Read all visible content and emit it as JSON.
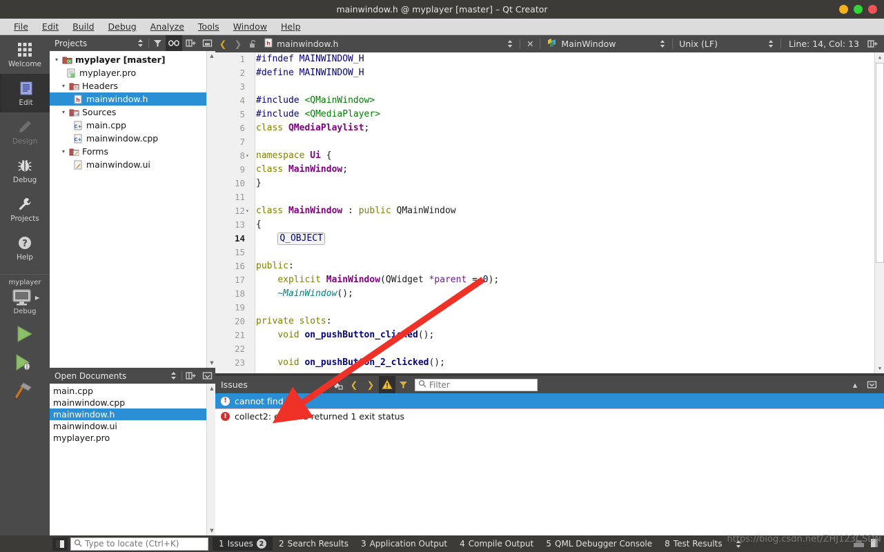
{
  "window": {
    "title": "mainwindow.h @ myplayer [master] – Qt Creator",
    "controls": {
      "minimize": "minimize",
      "maximize": "maximize",
      "close": "close"
    }
  },
  "menubar": [
    {
      "label": "File"
    },
    {
      "label": "Edit"
    },
    {
      "label": "Build"
    },
    {
      "label": "Debug"
    },
    {
      "label": "Analyze"
    },
    {
      "label": "Tools"
    },
    {
      "label": "Window"
    },
    {
      "label": "Help"
    }
  ],
  "modebar": {
    "items": [
      {
        "label": "Welcome",
        "icon": "grid-icon",
        "state": "normal"
      },
      {
        "label": "Edit",
        "icon": "document-icon",
        "state": "active"
      },
      {
        "label": "Design",
        "icon": "pencil-icon",
        "state": "disabled"
      },
      {
        "label": "Debug",
        "icon": "bug-icon",
        "state": "normal"
      },
      {
        "label": "Projects",
        "icon": "wrench-icon",
        "state": "normal"
      },
      {
        "label": "Help",
        "icon": "question-icon",
        "state": "normal"
      }
    ],
    "kit": {
      "project": "myplayer",
      "config": "Debug"
    },
    "actions": [
      {
        "name": "run",
        "icon": "play-icon"
      },
      {
        "name": "debug",
        "icon": "play-bug-icon"
      },
      {
        "name": "build",
        "icon": "hammer-icon"
      }
    ]
  },
  "projects_panel": {
    "title": "Projects",
    "toolbar": [
      {
        "name": "sort-button",
        "icon": "updown-icon"
      },
      {
        "name": "filter-button",
        "icon": "funnel-icon"
      },
      {
        "name": "synchronize-button",
        "icon": "link-icon",
        "active": true
      },
      {
        "name": "split-button",
        "icon": "split-icon"
      },
      {
        "name": "close-button",
        "icon": "close-panel-icon"
      }
    ],
    "tree": [
      {
        "label": "myplayer [master]",
        "depth": 0,
        "icon": "qt-project-icon",
        "twist": "open",
        "bold": true
      },
      {
        "label": "myplayer.pro",
        "depth": 1,
        "icon": "pro-file-icon",
        "twist": "none"
      },
      {
        "label": "Headers",
        "depth": 1,
        "icon": "headers-folder-icon",
        "twist": "open"
      },
      {
        "label": "mainwindow.h",
        "depth": 2,
        "icon": "header-file-icon",
        "twist": "none",
        "selected": true
      },
      {
        "label": "Sources",
        "depth": 1,
        "icon": "sources-folder-icon",
        "twist": "open"
      },
      {
        "label": "main.cpp",
        "depth": 2,
        "icon": "cpp-file-icon",
        "twist": "none"
      },
      {
        "label": "mainwindow.cpp",
        "depth": 2,
        "icon": "cpp-file-icon",
        "twist": "none"
      },
      {
        "label": "Forms",
        "depth": 1,
        "icon": "forms-folder-icon",
        "twist": "open"
      },
      {
        "label": "mainwindow.ui",
        "depth": 2,
        "icon": "ui-file-icon",
        "twist": "none"
      }
    ]
  },
  "open_documents": {
    "title": "Open Documents",
    "toolbar": [
      {
        "name": "sort-button",
        "icon": "updown-icon"
      },
      {
        "name": "split-button",
        "icon": "split-icon"
      },
      {
        "name": "close-button",
        "icon": "close-panel-icon"
      }
    ],
    "items": [
      {
        "label": "main.cpp"
      },
      {
        "label": "mainwindow.cpp"
      },
      {
        "label": "mainwindow.h",
        "selected": true
      },
      {
        "label": "mainwindow.ui"
      },
      {
        "label": "myplayer.pro"
      }
    ]
  },
  "editor": {
    "toolbar": {
      "back": "back-icon",
      "forward": "forward-icon",
      "lock": "unlocked-icon",
      "file_icon": "header-file-icon",
      "file_name": "mainwindow.h",
      "close": "close-icon",
      "symbol_icon": "class-icon",
      "symbol_name": "MainWindow",
      "line_ending": "Unix (LF)",
      "cursor_position": "Line: 14, Col: 13",
      "split_icon": "split-icon"
    },
    "lines": [
      {
        "n": 1,
        "fold": "",
        "tokens": [
          {
            "t": "#ifndef MAINWINDOW_H",
            "c": "c-pre"
          }
        ]
      },
      {
        "n": 2,
        "fold": "",
        "tokens": [
          {
            "t": "#define MAINWINDOW_H",
            "c": "c-pre"
          }
        ]
      },
      {
        "n": 3,
        "fold": "",
        "tokens": []
      },
      {
        "n": 4,
        "fold": "",
        "tokens": [
          {
            "t": "#include ",
            "c": "c-pre"
          },
          {
            "t": "<QMainWindow>",
            "c": "c-inc"
          }
        ]
      },
      {
        "n": 5,
        "fold": "",
        "tokens": [
          {
            "t": "#include ",
            "c": "c-pre"
          },
          {
            "t": "<QMediaPlayer>",
            "c": "c-inc"
          }
        ]
      },
      {
        "n": 6,
        "fold": "",
        "tokens": [
          {
            "t": "class ",
            "c": "c-kw"
          },
          {
            "t": "QMediaPlaylist",
            "c": "c-type"
          },
          {
            "t": ";",
            "c": "c-pln"
          }
        ]
      },
      {
        "n": 7,
        "fold": "",
        "tokens": []
      },
      {
        "n": 8,
        "fold": "open",
        "tokens": [
          {
            "t": "namespace ",
            "c": "c-kw"
          },
          {
            "t": "Ui",
            "c": "c-type"
          },
          {
            "t": " {",
            "c": "c-pln"
          }
        ]
      },
      {
        "n": 9,
        "fold": "",
        "tokens": [
          {
            "t": "class ",
            "c": "c-kw"
          },
          {
            "t": "MainWindow",
            "c": "c-type"
          },
          {
            "t": ";",
            "c": "c-pln"
          }
        ]
      },
      {
        "n": 10,
        "fold": "",
        "tokens": [
          {
            "t": "}",
            "c": "c-pln"
          }
        ]
      },
      {
        "n": 11,
        "fold": "",
        "tokens": []
      },
      {
        "n": 12,
        "fold": "open",
        "tokens": [
          {
            "t": "class ",
            "c": "c-kw"
          },
          {
            "t": "MainWindow",
            "c": "c-type"
          },
          {
            "t": " : ",
            "c": "c-pln"
          },
          {
            "t": "public ",
            "c": "c-kw"
          },
          {
            "t": "QMainWindow",
            "c": "c-pln"
          }
        ]
      },
      {
        "n": 13,
        "fold": "",
        "tokens": [
          {
            "t": "{",
            "c": "c-pln"
          }
        ]
      },
      {
        "n": 14,
        "fold": "",
        "current": true,
        "tokens": [
          {
            "t": "    ",
            "c": "c-pln"
          },
          {
            "t": "Q_OBJECT",
            "c": "c-pre",
            "box": true
          }
        ]
      },
      {
        "n": 15,
        "fold": "",
        "tokens": []
      },
      {
        "n": 16,
        "fold": "",
        "tokens": [
          {
            "t": "public",
            "c": "c-kw"
          },
          {
            "t": ":",
            "c": "c-pln"
          }
        ]
      },
      {
        "n": 17,
        "fold": "",
        "tokens": [
          {
            "t": "    ",
            "c": "c-pln"
          },
          {
            "t": "explicit ",
            "c": "c-kw"
          },
          {
            "t": "MainWindow",
            "c": "c-type"
          },
          {
            "t": "(",
            "c": "c-pln"
          },
          {
            "t": "QWidget ",
            "c": "c-pln"
          },
          {
            "t": "*parent",
            "c": "c-var"
          },
          {
            "t": " = ",
            "c": "c-pln"
          },
          {
            "t": "0",
            "c": "c-num"
          },
          {
            "t": ");",
            "c": "c-pln"
          }
        ]
      },
      {
        "n": 18,
        "fold": "",
        "tokens": [
          {
            "t": "    ",
            "c": "c-pln"
          },
          {
            "t": "~MainWindow",
            "c": "c-dtor"
          },
          {
            "t": "();",
            "c": "c-pln"
          }
        ]
      },
      {
        "n": 19,
        "fold": "",
        "tokens": []
      },
      {
        "n": 20,
        "fold": "",
        "tokens": [
          {
            "t": "private slots",
            "c": "c-kw"
          },
          {
            "t": ":",
            "c": "c-pln"
          }
        ]
      },
      {
        "n": 21,
        "fold": "",
        "tokens": [
          {
            "t": "    ",
            "c": "c-pln"
          },
          {
            "t": "void ",
            "c": "c-kw"
          },
          {
            "t": "on_pushButton_clicked",
            "c": "c-fn"
          },
          {
            "t": "();",
            "c": "c-pln"
          }
        ]
      },
      {
        "n": 22,
        "fold": "",
        "tokens": []
      },
      {
        "n": 23,
        "fold": "",
        "tokens": [
          {
            "t": "    ",
            "c": "c-pln"
          },
          {
            "t": "void ",
            "c": "c-kw"
          },
          {
            "t": "on_pushButton_2_clicked",
            "c": "c-fn"
          },
          {
            "t": "();",
            "c": "c-pln"
          }
        ]
      }
    ]
  },
  "issues_panel": {
    "title": "Issues",
    "toolbar": [
      {
        "name": "clear-button",
        "icon": "clear-icon"
      },
      {
        "name": "previous-button",
        "icon": "chevron-left-icon"
      },
      {
        "name": "next-button",
        "icon": "chevron-right-icon"
      },
      {
        "name": "warnings-filter-button",
        "icon": "warning-triangle-icon",
        "active": true
      },
      {
        "name": "filter-button",
        "icon": "funnel-icon"
      }
    ],
    "filter_placeholder": "Filter",
    "filter_value": "",
    "collapse_icon": "chevron-up-icon",
    "maximize_icon": "maximize-panel-icon",
    "rows": [
      {
        "severity": "error",
        "text": "cannot find -lGL",
        "selected": true
      },
      {
        "severity": "error",
        "text": "collect2: error: ld returned 1 exit status",
        "selected": false
      }
    ]
  },
  "statusbar": {
    "locator_icon": "locator-icon",
    "locator_placeholder": "Type to locate (Ctrl+K)",
    "locator_value": "",
    "search_icon": "search-icon",
    "output_tabs": [
      {
        "num": "1",
        "label": "Issues",
        "badge": "2",
        "active": true
      },
      {
        "num": "2",
        "label": "Search Results",
        "badge": "",
        "active": false
      },
      {
        "num": "3",
        "label": "Application Output",
        "badge": "",
        "active": false
      },
      {
        "num": "4",
        "label": "Compile Output",
        "badge": "",
        "active": false
      },
      {
        "num": "5",
        "label": "QML Debugger Console",
        "badge": "",
        "active": false
      },
      {
        "num": "8",
        "label": "Test Results",
        "badge": "",
        "active": false
      }
    ],
    "more_icon": "updown-icon"
  },
  "watermark": {
    "text": "https://blog.csdn.net/ZHJ123CSDN"
  },
  "colors": {
    "selection": "#2a8fd4",
    "error": "#d03030",
    "accent": "#d9b13a"
  }
}
